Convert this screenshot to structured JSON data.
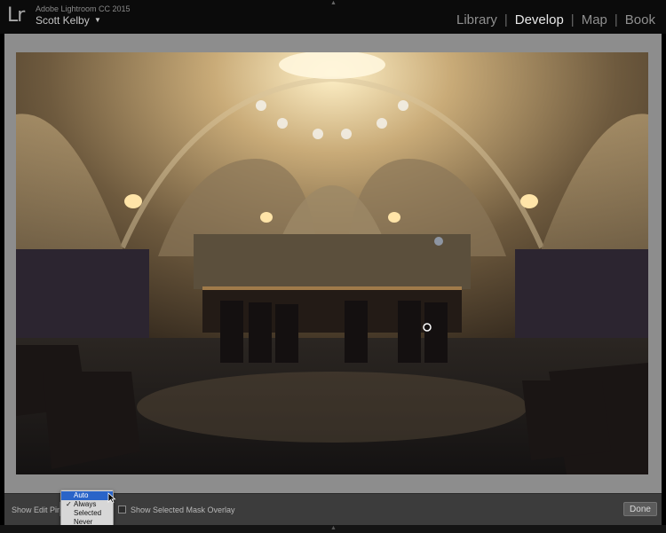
{
  "identity": {
    "logo": "Lr",
    "version": "Adobe Lightroom CC 2015",
    "user": "Scott Kelby",
    "caret": "▼"
  },
  "modules": [
    {
      "label": "Library",
      "active": false
    },
    {
      "label": "Develop",
      "active": true
    },
    {
      "label": "Map",
      "active": false
    },
    {
      "label": "Book",
      "active": false
    }
  ],
  "module_separator": "|",
  "toolbar": {
    "show_edit_pins_label": "Show Edit Pins",
    "mask_overlay_label": "Show Selected Mask Overlay",
    "done_label": "Done"
  },
  "pin_menu": {
    "items": [
      {
        "label": "Auto",
        "highlighted": true,
        "checked": false
      },
      {
        "label": "Always",
        "highlighted": false,
        "checked": true
      },
      {
        "label": "Selected",
        "highlighted": false,
        "checked": false
      },
      {
        "label": "Never",
        "highlighted": false,
        "checked": false
      }
    ],
    "check_glyph": "✓"
  },
  "icons": {
    "panel_arrow_top": "▲",
    "panel_arrow_bottom": "▲"
  }
}
